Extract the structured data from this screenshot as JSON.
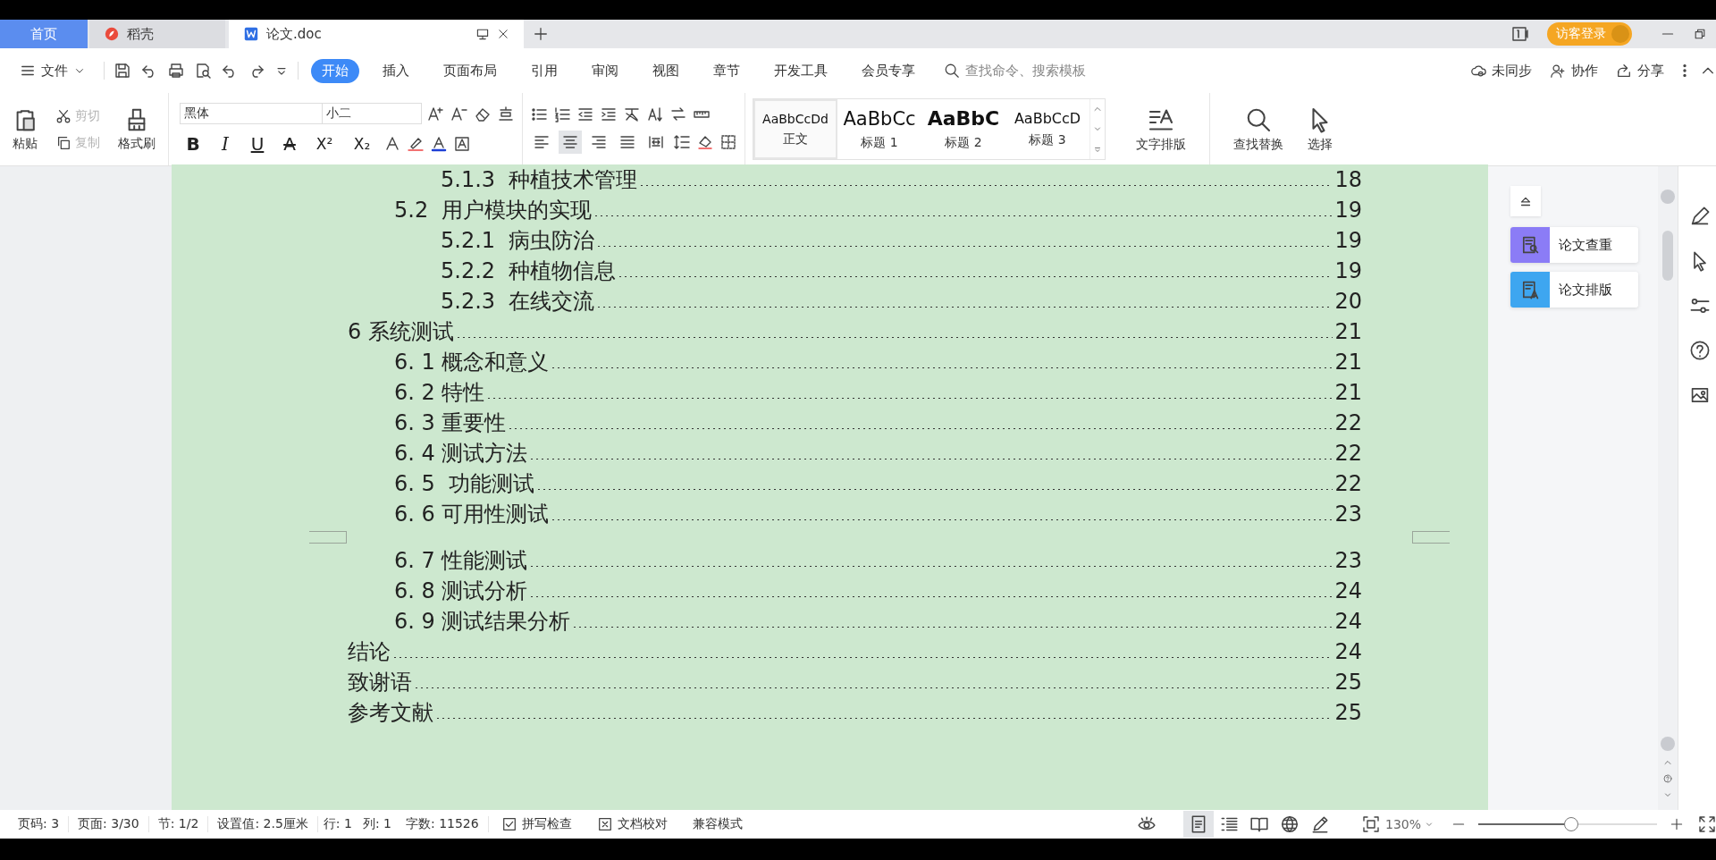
{
  "window": {
    "tabs": [
      {
        "label": "首页",
        "kind": "home",
        "selected": false
      },
      {
        "label": "稻壳",
        "kind": "docer",
        "selected": false
      },
      {
        "label": "论文.doc",
        "kind": "document",
        "selected": true
      }
    ],
    "guest_login": "访客登录"
  },
  "menu": {
    "file": "文件",
    "tabs": [
      {
        "label": "开始",
        "selected": true
      },
      {
        "label": "插入",
        "selected": false
      },
      {
        "label": "页面布局",
        "selected": false
      },
      {
        "label": "引用",
        "selected": false
      },
      {
        "label": "审阅",
        "selected": false
      },
      {
        "label": "视图",
        "selected": false
      },
      {
        "label": "章节",
        "selected": false
      },
      {
        "label": "开发工具",
        "selected": false
      },
      {
        "label": "会员专享",
        "selected": false
      }
    ],
    "search": {
      "placeholder": "查找命令、搜索模板"
    },
    "actions": [
      "未同步",
      "协作",
      "分享"
    ]
  },
  "ribbon": {
    "paste": "粘贴",
    "cut": {
      "label": "剪切",
      "disabled": true
    },
    "copy": {
      "label": "复制",
      "disabled": true
    },
    "format_painter": "格式刷",
    "font": "黑体",
    "font_size": "小二",
    "text_format": [
      "B",
      "I",
      "U",
      "A",
      "X²",
      "X₂"
    ],
    "align": [
      {
        "kind": "left",
        "selected": false
      },
      {
        "kind": "center",
        "selected": true
      },
      {
        "kind": "right",
        "selected": false
      },
      {
        "kind": "justify",
        "selected": false
      },
      {
        "kind": "distributed",
        "selected": false
      }
    ],
    "styles": [
      {
        "preview": "AaBbCcDd",
        "label": "正文",
        "kind": "body",
        "selected": true
      },
      {
        "preview": "AaBbCc",
        "label": "标题 1",
        "kind": "h1",
        "selected": false
      },
      {
        "preview": "AaBbC",
        "label": "标题 2",
        "kind": "h2",
        "selected": false
      },
      {
        "preview": "AaBbCcD",
        "label": "标题 3",
        "kind": "h3",
        "selected": false
      }
    ],
    "text_layout": "文字排版",
    "find_replace": "查找替换",
    "select": "选择"
  },
  "document": {
    "toc": [
      {
        "children": [
          {
            "children": [
              {
                "text": "5.1.3  种植技术管理",
                "page": "18",
                "page_break_before": false
              }
            ]
          },
          {
            "text": "5.2  用户模块的实现",
            "page": "19",
            "page_break_before": false,
            "children": [
              {
                "text": "5.2.1  病虫防治",
                "page": "19",
                "page_break_before": false
              },
              {
                "text": "5.2.2  种植物信息",
                "page": "19",
                "page_break_before": false
              },
              {
                "text": "5.2.3  在线交流",
                "page": "20",
                "page_break_before": false
              }
            ]
          }
        ]
      },
      {
        "text": "6 系统测试",
        "page": "21",
        "page_break_before": false,
        "children": [
          {
            "text": "6. 1 概念和意义",
            "page": "21",
            "page_break_before": false
          },
          {
            "text": "6. 2 特性",
            "page": "21",
            "page_break_before": false
          },
          {
            "text": "6. 3 重要性",
            "page": "22",
            "page_break_before": false
          },
          {
            "text": "6. 4 测试方法",
            "page": "22",
            "page_break_before": false
          },
          {
            "text": "6. 5  功能测试",
            "page": "22",
            "page_break_before": false
          },
          {
            "text": "6. 6 可用性测试",
            "page": "23",
            "page_break_before": false
          },
          {
            "text": "6. 7 性能测试",
            "page": "23",
            "page_break_before": true
          },
          {
            "text": "6. 8 测试分析",
            "page": "24",
            "page_break_before": false
          },
          {
            "text": "6. 9 测试结果分析",
            "page": "24",
            "page_break_before": false
          }
        ]
      },
      {
        "text": "结论",
        "page": "24",
        "page_break_before": false
      },
      {
        "text": "致谢语",
        "page": "25",
        "page_break_before": false
      },
      {
        "text": "参考文献",
        "page": "25",
        "page_break_before": false
      }
    ]
  },
  "side_panel": {
    "tools": [
      {
        "label": "论文查重",
        "color": "#8b7cf6"
      },
      {
        "label": "论文排版",
        "color": "#3ea6f0"
      }
    ]
  },
  "status_bar": {
    "fields": [
      "页码: 3",
      "页面: 3/30",
      "节: 1/2",
      "设置值: 2.5厘米",
      "行: 1",
      "列: 1",
      "字数: 11526"
    ],
    "spell_check": "拼写检查",
    "proofread": "文档校对",
    "compat_mode": "兼容模式",
    "view_modes": [
      {
        "kind": "page",
        "selected": true
      },
      {
        "kind": "outline",
        "selected": false
      },
      {
        "kind": "reading",
        "selected": false
      },
      {
        "kind": "web",
        "selected": false
      },
      {
        "kind": "write",
        "selected": false
      }
    ],
    "zoom": "130%",
    "zoom_slider": {
      "level": 0.52
    }
  }
}
